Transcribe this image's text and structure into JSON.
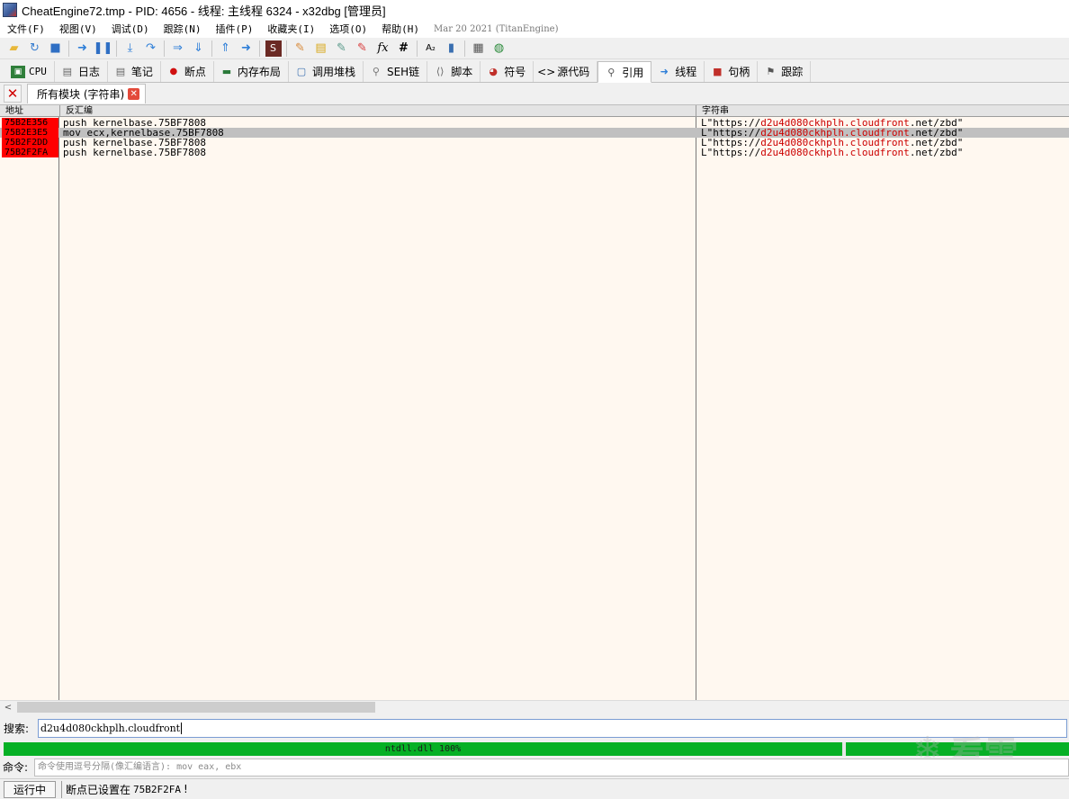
{
  "window": {
    "title": "CheatEngine72.tmp - PID: 4656 - 线程: 主线程 6324 - x32dbg [管理员]"
  },
  "menu": {
    "items": [
      "文件(F)",
      "视图(V)",
      "调试(D)",
      "跟踪(N)",
      "插件(P)",
      "收藏夹(I)",
      "选项(O)",
      "帮助(H)"
    ],
    "build_date": "Mar 20 2021 (TitanEngine)"
  },
  "toolbar": {
    "buttons": [
      "open-icon",
      "restart-icon",
      "stop-icon",
      "run-icon",
      "pause-icon",
      "step-into-icon",
      "step-over-icon",
      "trace-into-icon",
      "trace-over-icon",
      "execute-till-return-icon",
      "run-to-user-code-icon",
      "scylla-icon",
      "patch-icon",
      "comment-icon",
      "label-icon",
      "bookmark-icon",
      "function-icon",
      "hash-icon",
      "strings-icon",
      "calls-icon",
      "calculator-icon",
      "globe-icon"
    ]
  },
  "tabs": [
    {
      "label": "CPU",
      "icon": "cpu-icon"
    },
    {
      "label": "日志",
      "icon": "log-icon"
    },
    {
      "label": "笔记",
      "icon": "notes-icon"
    },
    {
      "label": "断点",
      "icon": "breakpoint-icon"
    },
    {
      "label": "内存布局",
      "icon": "memory-map-icon"
    },
    {
      "label": "调用堆栈",
      "icon": "call-stack-icon"
    },
    {
      "label": "SEH链",
      "icon": "seh-chain-icon"
    },
    {
      "label": "脚本",
      "icon": "script-icon"
    },
    {
      "label": "符号",
      "icon": "symbols-icon"
    },
    {
      "label": "源代码",
      "icon": "source-icon"
    },
    {
      "label": "引用",
      "icon": "references-icon",
      "active": true
    },
    {
      "label": "线程",
      "icon": "threads-icon"
    },
    {
      "label": "句柄",
      "icon": "handles-icon"
    },
    {
      "label": "跟踪",
      "icon": "trace-icon"
    }
  ],
  "subtab": {
    "label": "所有模块 (字符串)"
  },
  "table": {
    "headers": {
      "address": "地址",
      "disassembly": "反汇编",
      "string": "字符串"
    },
    "rows": [
      {
        "address": "75B2E356",
        "disassembly": "push kernelbase.75BF7808",
        "string_prefix": "L\"https://",
        "string_match": "d2u4d080ckhplh.cloudfront",
        "string_suffix": ".net/zbd\"",
        "selected": false
      },
      {
        "address": "75B2E3E5",
        "disassembly": "mov ecx,kernelbase.75BF7808",
        "string_prefix": "L\"https://",
        "string_match": "d2u4d080ckhplh.cloudfront",
        "string_suffix": ".net/zbd\"",
        "selected": true
      },
      {
        "address": "75B2F2DD",
        "disassembly": "push kernelbase.75BF7808",
        "string_prefix": "L\"https://",
        "string_match": "d2u4d080ckhplh.cloudfront",
        "string_suffix": ".net/zbd\"",
        "selected": false
      },
      {
        "address": "75B2F2FA",
        "disassembly": "push kernelbase.75BF7808",
        "string_prefix": "L\"https://",
        "string_match": "d2u4d080ckhplh.cloudfront",
        "string_suffix": ".net/zbd\"",
        "selected": false
      }
    ],
    "colors": {
      "address_highlight": "#ff0000",
      "match_text": "#cc0000",
      "selected_row": "#c0c0c0",
      "background": "#fff8f0"
    }
  },
  "search": {
    "label": "搜索:",
    "value": "d2u4d080ckhplh.cloudfront"
  },
  "progress": {
    "label": "ntdll.dll 100%",
    "value": 1.0
  },
  "command": {
    "label": "命令:",
    "placeholder": "命令使用逗号分隔(像汇编语言): mov eax, ebx"
  },
  "status": {
    "state": "运行中",
    "message_prefix": "断点已设置在",
    "message_address": "75B2F2FA",
    "message_suffix": "!"
  },
  "watermark": {
    "text": "看雪"
  }
}
